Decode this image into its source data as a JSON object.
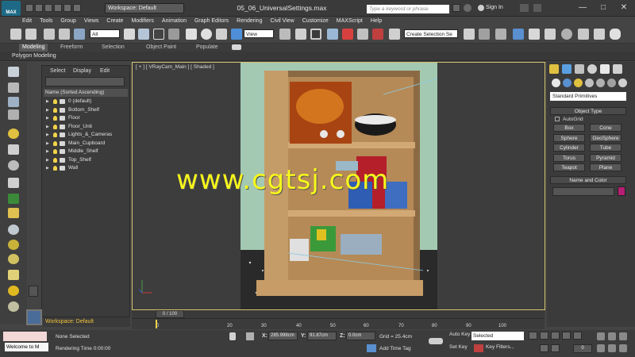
{
  "title_bar": {
    "logo_text": "MAX",
    "workspace": "Workspace: Default",
    "window_title": "05_06_UniversalSettings.max",
    "search_placeholder": "Type a keyword or phrase",
    "sign_in": "Sign In",
    "minimize": "—",
    "maximize": "□",
    "close": "✕"
  },
  "menu": [
    "Edit",
    "Tools",
    "Group",
    "Views",
    "Create",
    "Modifiers",
    "Animation",
    "Graph Editors",
    "Rendering",
    "Civil View",
    "Customize",
    "MAXScript",
    "Help"
  ],
  "toolbar": {
    "filter": "All",
    "ref_coord": "View",
    "selection_set": "Create Selection Se"
  },
  "ribbon": {
    "tabs": [
      "Modeling",
      "Freeform",
      "Selection",
      "Object Paint",
      "Populate"
    ],
    "active_tab": "Modeling",
    "sub_label": "Polygon Modeling"
  },
  "explorer": {
    "menu": [
      "Select",
      "Display",
      "Edit"
    ],
    "header": "Name (Sorted Ascending)",
    "items": [
      "0 (default)",
      "Bottom_Shelf",
      "Floor",
      "Floor_Unit",
      "Lights_&_Cameras",
      "Main_Cupboard",
      "Middle_Shelf",
      "Top_Shelf",
      "Wall"
    ]
  },
  "viewport": {
    "label": "[ + ] [ VRayCam_Main ] [ Shaded ]"
  },
  "watermark": "www.cgtsj.com",
  "command_panel": {
    "dropdown": "Standard Primitives",
    "object_type_title": "Object Type",
    "autogrid": "AutoGrid",
    "primitives": [
      "Box",
      "Cone",
      "Sphere",
      "GeoSphere",
      "Cylinder",
      "Tube",
      "Torus",
      "Pyramid",
      "Teapot",
      "Plane"
    ],
    "name_color_title": "Name and Color",
    "color": "#b51e73"
  },
  "timeline": {
    "slider": "0 / 100",
    "ticks": [
      "0",
      "20",
      "30",
      "40",
      "50",
      "60",
      "70",
      "80",
      "90",
      "100"
    ]
  },
  "workspace_bottom": "Workspace: Default",
  "status": {
    "maxscript_text": "Welcome to M",
    "selection": "None Selected",
    "render_time": "Rendering Time  0:00:00",
    "x_label": "X:",
    "x_value": "285.998cm",
    "y_label": "Y:",
    "y_value": "91.87cm",
    "z_label": "Z:",
    "z_value": "0.0cm",
    "grid": "Grid = 25.4cm",
    "add_time_tag": "Add Time Tag",
    "auto_key": "Auto Key",
    "set_key": "Set Key",
    "selected": "Selected",
    "key_filters": "Key Filters...",
    "frame": "0"
  }
}
